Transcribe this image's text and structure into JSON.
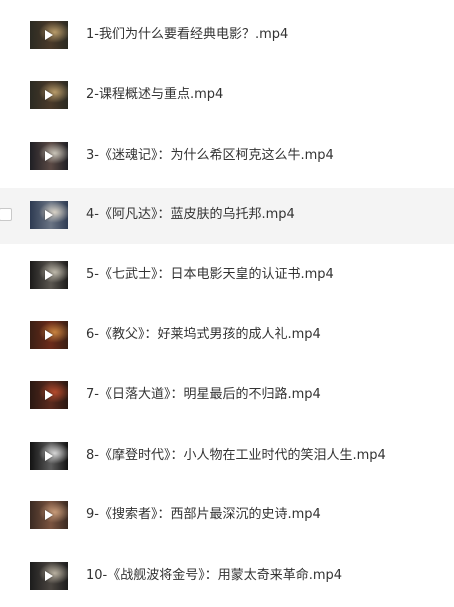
{
  "files": [
    {
      "name": "1-我们为什么要看经典电影？.mp4",
      "thumb": "video-thumbnail",
      "colors": [
        "#2b2a22",
        "#b79b6a",
        "#4a3a2a"
      ]
    },
    {
      "name": "2-课程概述与重点.mp4",
      "thumb": "video-thumbnail",
      "colors": [
        "#2b2a22",
        "#b79b6a",
        "#4a3a2a"
      ]
    },
    {
      "name": "3-《迷魂记》：为什么希区柯克这么牛.mp4",
      "thumb": "video-thumbnail",
      "colors": [
        "#1f1f24",
        "#c9c4b8",
        "#5b4a45"
      ]
    },
    {
      "name": "4-《阿凡达》：蓝皮肤的乌托邦.mp4",
      "thumb": "video-thumbnail",
      "colors": [
        "#2e3b52",
        "#d8d2c6",
        "#6a7484"
      ]
    },
    {
      "name": "5-《七武士》：日本电影天皇的认证书.mp4",
      "thumb": "video-thumbnail",
      "colors": [
        "#1c1b1a",
        "#bdb8aa",
        "#5a5650"
      ]
    },
    {
      "name": "6-《教父》：好莱坞式男孩的成人礼.mp4",
      "thumb": "video-thumbnail",
      "colors": [
        "#3a1f14",
        "#c7833f",
        "#6b2b1a"
      ]
    },
    {
      "name": "7-《日落大道》：明星最后的不归路.mp4",
      "thumb": "video-thumbnail",
      "colors": [
        "#2a1812",
        "#b34a2c",
        "#5a2a1e"
      ]
    },
    {
      "name": "8-《摩登时代》：小人物在工业时代的笑泪人生.mp4",
      "thumb": "video-thumbnail",
      "colors": [
        "#121212",
        "#d6d6d6",
        "#5c5c5c"
      ]
    },
    {
      "name": "9-《搜索者》：西部片最深沉的史诗.mp4",
      "thumb": "video-thumbnail",
      "colors": [
        "#3a2a22",
        "#c69a78",
        "#7a5440"
      ]
    },
    {
      "name": "10-《战舰波将金号》：用蒙太奇来革命.mp4",
      "thumb": "video-thumbnail",
      "colors": [
        "#1c1c1c",
        "#b8b0a0",
        "#4a4540"
      ]
    }
  ],
  "hovered_index": 3,
  "colors": {
    "text": "#333333",
    "hover_background": "#f4f4f4",
    "checkbox_border": "#c9c9c9"
  }
}
